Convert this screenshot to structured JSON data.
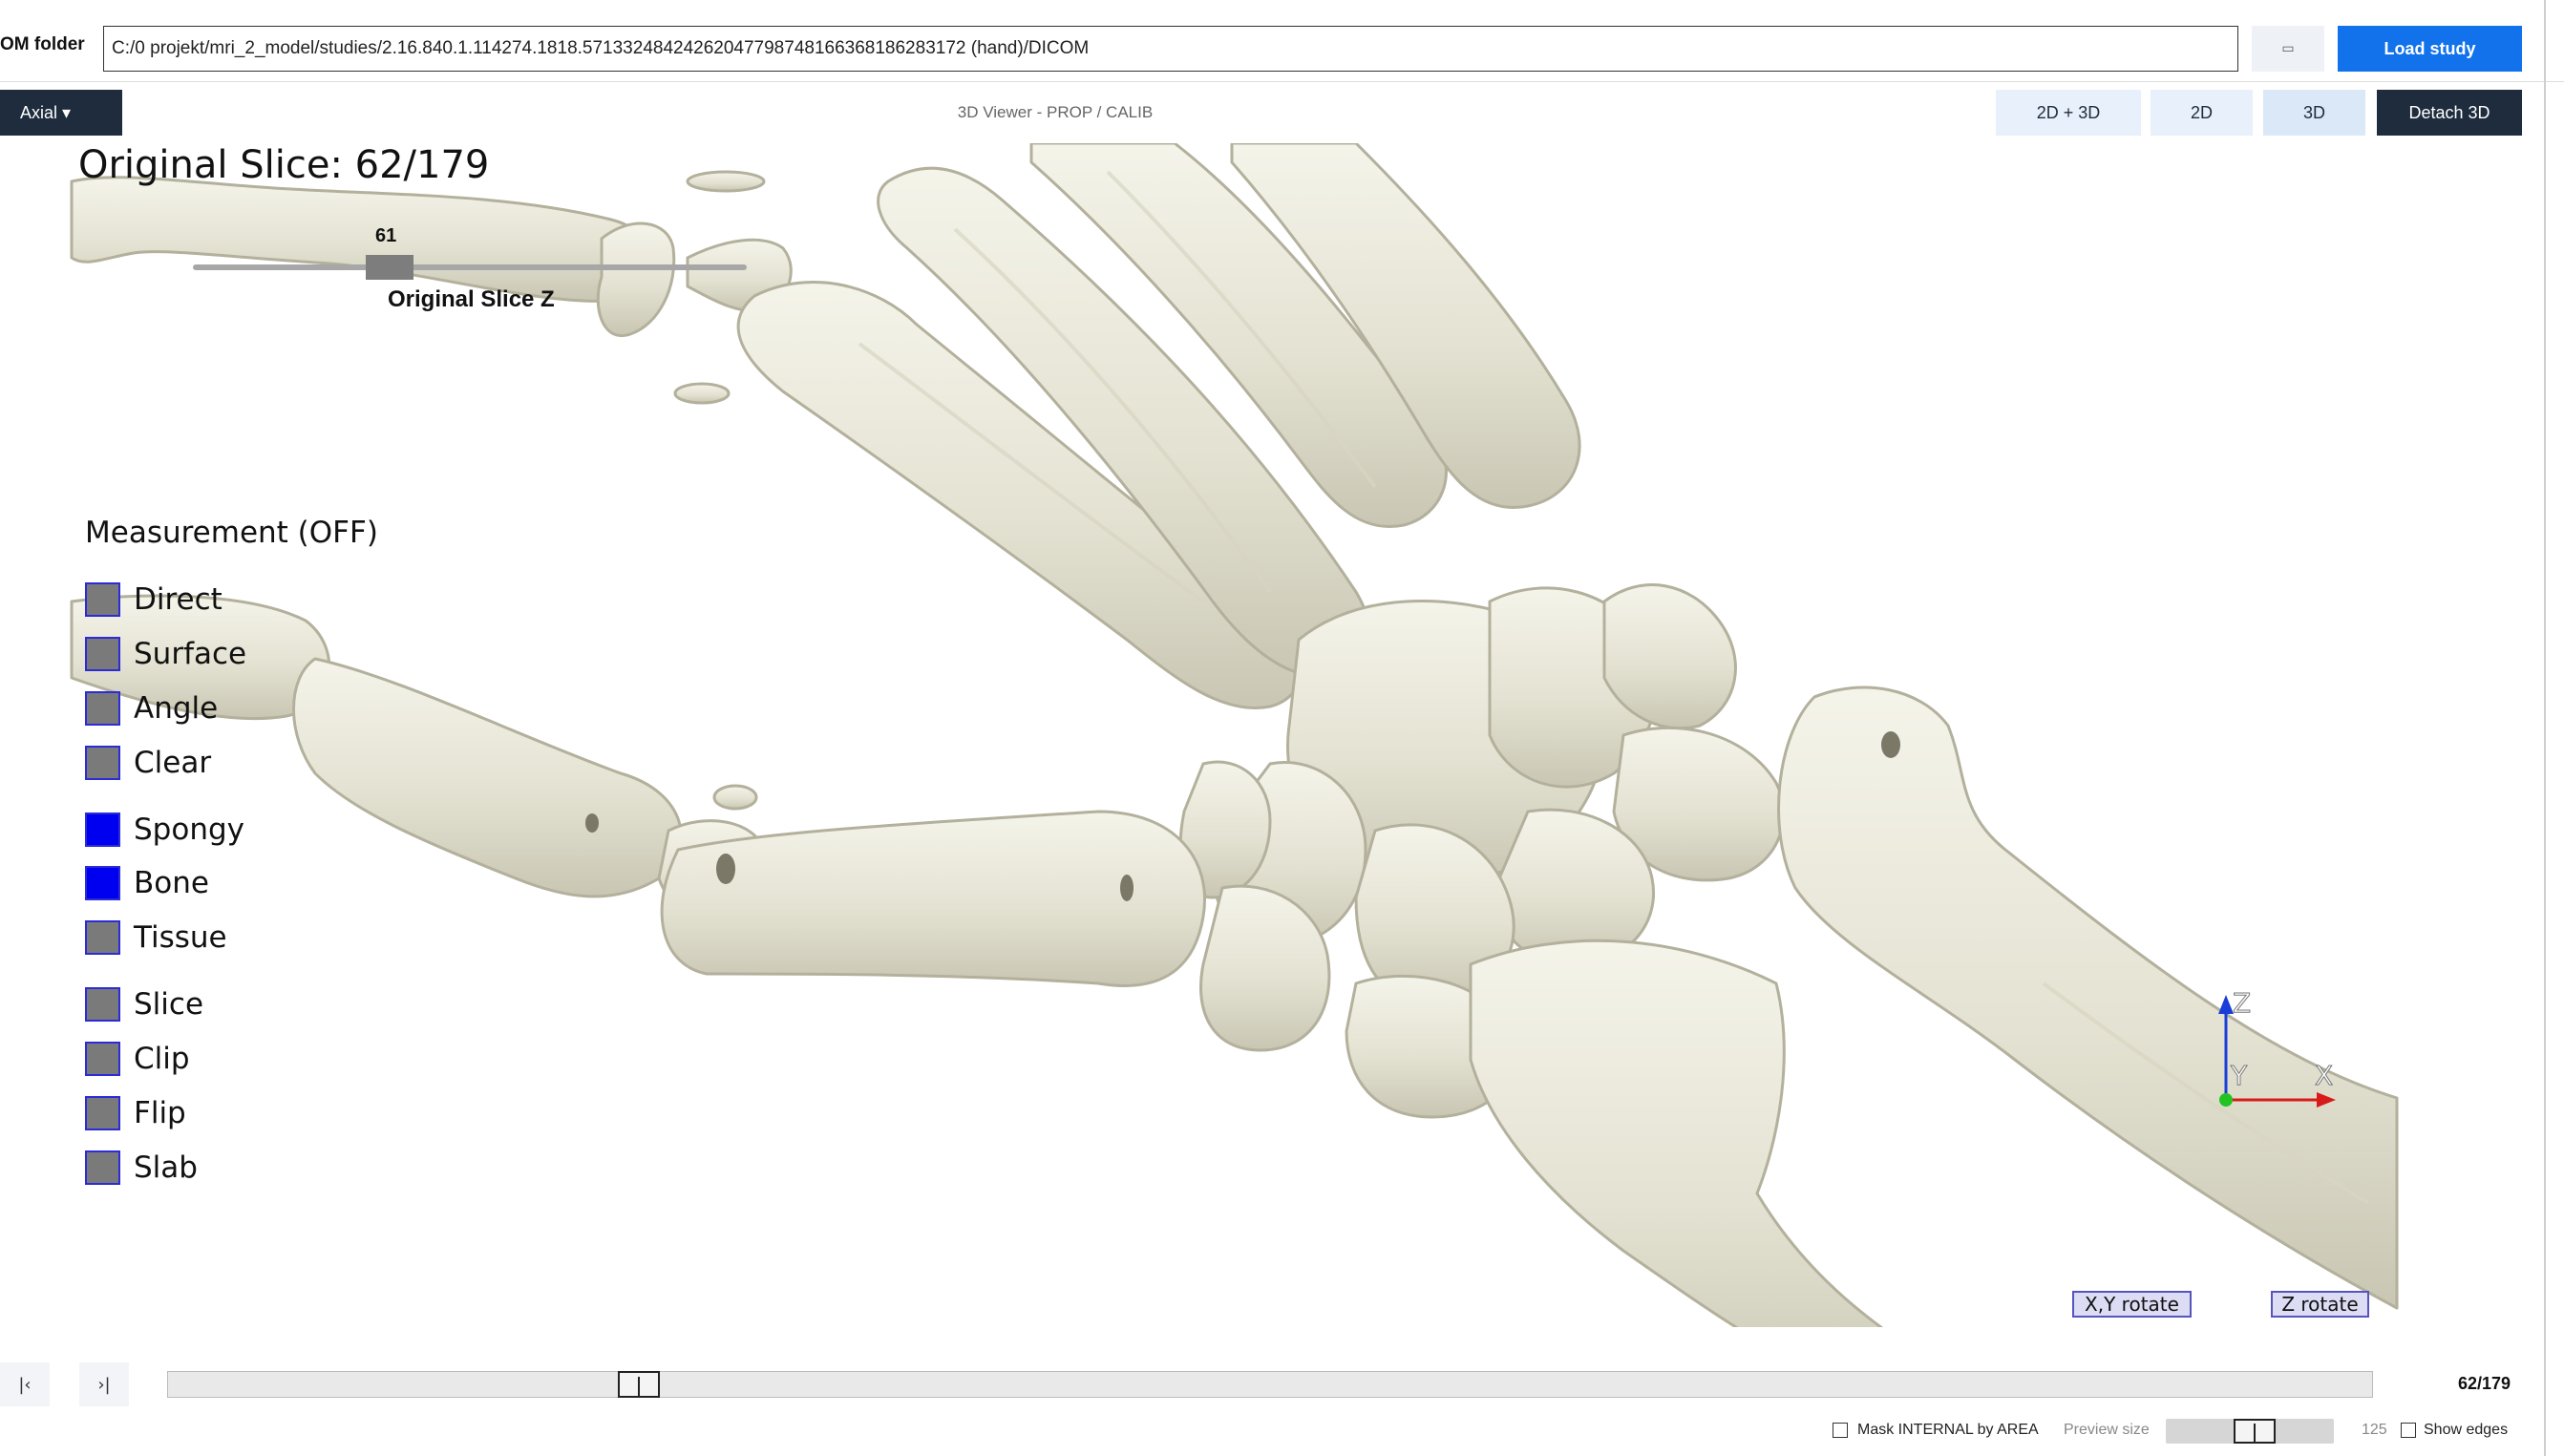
{
  "toolbar": {
    "folder_label": "OM folder",
    "path": "C:/0 projekt/mri_2_model/studies/2.16.840.1.114274.1818.57133248424262047798748166368186283172 (hand)/DICOM",
    "browse_icon": "folder-icon",
    "browse_glyph": "▭",
    "load_label": "Load study"
  },
  "viewbar": {
    "view_select": "Axial ▾",
    "title": "3D Viewer - PROP / CALIB",
    "modes": [
      "2D + 3D",
      "2D",
      "3D"
    ],
    "detach_label": "Detach 3D"
  },
  "overlay": {
    "slice_title": "Original Slice: 62/179",
    "slider_value": "61",
    "slider_label": "Original Slice Z",
    "measurement_title": "Measurement (OFF)",
    "options": [
      {
        "label": "Direct",
        "checked": false
      },
      {
        "label": "Surface",
        "checked": false
      },
      {
        "label": "Angle",
        "checked": false
      },
      {
        "label": "Clear",
        "checked": false
      },
      {
        "label": "Spongy",
        "checked": true
      },
      {
        "label": "Bone",
        "checked": true
      },
      {
        "label": "Tissue",
        "checked": false
      },
      {
        "label": "Slice",
        "checked": false
      },
      {
        "label": "Clip",
        "checked": false
      },
      {
        "label": "Flip",
        "checked": false
      },
      {
        "label": "Slab",
        "checked": false
      }
    ],
    "axes": {
      "z": "Z",
      "y": "Y",
      "x": "X"
    },
    "xy_rotate": "X,Y rotate",
    "z_rotate": "Z rotate",
    "colors": {
      "checked": "#0000f0",
      "unchecked": "#7a7a7a",
      "bone": "#ecebde",
      "axis_z": "#1a3fd8",
      "axis_x": "#d81a1a",
      "axis_y": "#22c422"
    }
  },
  "slicebar": {
    "first_glyph": "|‹",
    "next_glyph": "›|",
    "current": 62,
    "total": 179,
    "count_text": "62/179"
  },
  "footer": {
    "mask_label": "Mask INTERNAL by AREA",
    "mask_checked": false,
    "preview_label": "Preview size",
    "preview_value": "125",
    "edges_label": "Show edges",
    "edges_checked": false
  }
}
